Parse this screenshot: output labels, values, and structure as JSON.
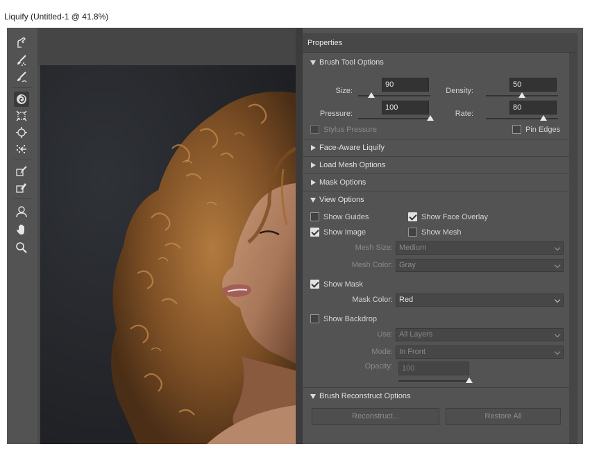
{
  "window": {
    "title": "Liquify (Untitled-1 @ 41.8%)"
  },
  "toolbar": {
    "tools": [
      {
        "name": "forward-warp-tool",
        "icon": "finger-warp-icon"
      },
      {
        "name": "reconstruct-tool",
        "icon": "reconstruct-brush-icon"
      },
      {
        "name": "smooth-tool",
        "icon": "smooth-brush-icon"
      },
      {
        "name": "twirl-clockwise-tool",
        "icon": "twirl-icon",
        "active": true
      },
      {
        "name": "pucker-tool",
        "icon": "pucker-icon"
      },
      {
        "name": "bloat-tool",
        "icon": "bloat-icon"
      },
      {
        "name": "push-left-tool",
        "icon": "push-left-icon"
      },
      {
        "name": "freeze-mask-tool",
        "icon": "freeze-mask-icon"
      },
      {
        "name": "thaw-mask-tool",
        "icon": "thaw-mask-icon"
      },
      {
        "name": "face-tool",
        "icon": "face-icon"
      },
      {
        "name": "hand-tool",
        "icon": "hand-icon"
      },
      {
        "name": "zoom-tool",
        "icon": "zoom-icon"
      }
    ]
  },
  "panel": {
    "title": "Properties",
    "brush_tool_options": {
      "label": "Brush Tool Options",
      "size_label": "Size:",
      "size_value": "90",
      "size_fraction": 0.18,
      "density_label": "Density:",
      "density_value": "50",
      "density_fraction": 0.5,
      "pressure_label": "Pressure:",
      "pressure_value": "100",
      "pressure_fraction": 1.0,
      "rate_label": "Rate:",
      "rate_value": "80",
      "rate_fraction": 0.8,
      "stylus_pressure_label": "Stylus Pressure",
      "stylus_pressure_checked": false,
      "pin_edges_label": "Pin Edges",
      "pin_edges_checked": false
    },
    "face_aware": {
      "label": "Face-Aware Liquify"
    },
    "load_mesh": {
      "label": "Load Mesh Options"
    },
    "mask_options": {
      "label": "Mask Options"
    },
    "view_options": {
      "label": "View Options",
      "show_guides_label": "Show Guides",
      "show_guides_checked": false,
      "show_face_overlay_label": "Show Face Overlay",
      "show_face_overlay_checked": true,
      "show_image_label": "Show Image",
      "show_image_checked": true,
      "show_mesh_label": "Show Mesh",
      "show_mesh_checked": false,
      "mesh_size_label": "Mesh Size:",
      "mesh_size_value": "Medium",
      "mesh_color_label": "Mesh Color:",
      "mesh_color_value": "Gray",
      "show_mask_label": "Show Mask",
      "show_mask_checked": true,
      "mask_color_label": "Mask Color:",
      "mask_color_value": "Red",
      "show_backdrop_label": "Show Backdrop",
      "show_backdrop_checked": false,
      "use_label": "Use:",
      "use_value": "All Layers",
      "mode_label": "Mode:",
      "mode_value": "In Front",
      "opacity_label": "Opacity:",
      "opacity_value": "100",
      "opacity_fraction": 1.0
    },
    "brush_reconstruct": {
      "label": "Brush Reconstruct Options",
      "reconstruct_label": "Reconstruct...",
      "restore_all_label": "Restore All"
    }
  },
  "colors": {
    "panel_bg": "#535353",
    "field_bg": "#333333",
    "canvas_bg": "#232529",
    "hair": "#8a5a2b",
    "skin": "#b98a6b"
  }
}
